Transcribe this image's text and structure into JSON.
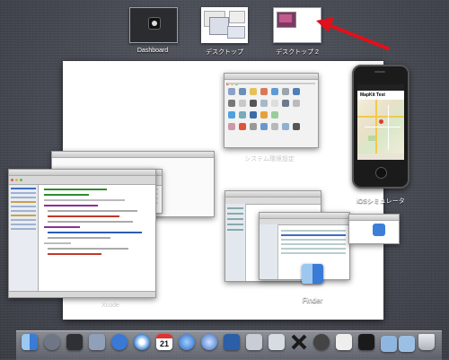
{
  "spaces": {
    "dashboard_label": "Dashboard",
    "desktop1_label": "デスクトップ",
    "desktop2_label": "デスクトップ 2"
  },
  "windows": {
    "system_prefs_label": "システム環境設定",
    "ios_sim_label": "iOSシミュレータ",
    "xcode_label": "Xcode",
    "finder_label": "Finder",
    "mapkit_title": "MapKit Test"
  },
  "arrow_color": "#e0111a",
  "dock": {
    "items": [
      "finder-icon",
      "launchpad-icon",
      "mission-control-icon",
      "mail-icon",
      "app-store-icon",
      "safari-icon",
      "calendar-icon",
      "itunes-icon",
      "quicktime-icon",
      "xcode-icon",
      "preview-icon",
      "tools-icon",
      "x11-icon",
      "camera-icon",
      "textedit-icon",
      "terminal-icon",
      "downloads-folder-icon",
      "documents-folder-icon",
      "trash-icon"
    ],
    "calendar_day": "21"
  }
}
